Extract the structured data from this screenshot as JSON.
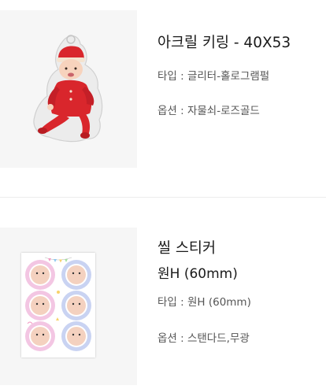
{
  "items": [
    {
      "title": "아크릴 키링 - 40X53",
      "subtitle": "",
      "options": [
        "타입 : 글리터-홀로그램펄",
        "옵션 : 자물쇠-로즈골드"
      ]
    },
    {
      "title": "씰 스티커",
      "subtitle": "원H (60mm)",
      "options": [
        "타입 : 원H (60mm)",
        "옵션 : 스탠다드,무광"
      ]
    }
  ],
  "colors": {
    "thumb_bg": "#f6f6f6",
    "sticker_pink": "#f3c6e3",
    "sticker_blue": "#c9d3f2",
    "baby_suit": "#d9262c"
  },
  "icons": {
    "keyring": "acrylic-keyring-baby-image",
    "sticker": "seal-sticker-sheet-image"
  }
}
